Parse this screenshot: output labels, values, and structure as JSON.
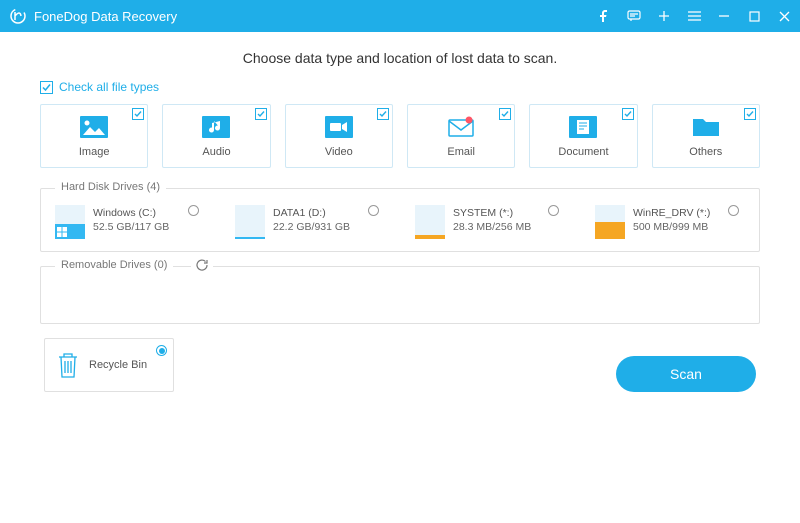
{
  "app": {
    "title": "FoneDog Data Recovery"
  },
  "heading": "Choose data type and location of lost data to scan.",
  "checkall_label": "Check all file types",
  "types": [
    {
      "label": "Image",
      "icon": "image"
    },
    {
      "label": "Audio",
      "icon": "audio"
    },
    {
      "label": "Video",
      "icon": "video"
    },
    {
      "label": "Email",
      "icon": "email"
    },
    {
      "label": "Document",
      "icon": "document"
    },
    {
      "label": "Others",
      "icon": "others"
    }
  ],
  "hdd": {
    "title": "Hard Disk Drives (4)",
    "drives": [
      {
        "name": "Windows (C:)",
        "size": "52.5 GB/117 GB",
        "fill_pct": 45,
        "color": "blue",
        "os": true
      },
      {
        "name": "DATA1 (D:)",
        "size": "22.2 GB/931 GB",
        "fill_pct": 3,
        "color": "blue",
        "os": false
      },
      {
        "name": "SYSTEM (*:)",
        "size": "28.3 MB/256 MB",
        "fill_pct": 11,
        "color": "orange",
        "os": false
      },
      {
        "name": "WinRE_DRV (*:)",
        "size": "500 MB/999 MB",
        "fill_pct": 50,
        "color": "orange",
        "os": false
      }
    ]
  },
  "removable": {
    "title": "Removable Drives (0)"
  },
  "recycle": {
    "label": "Recycle Bin",
    "selected": true
  },
  "scan_label": "Scan"
}
